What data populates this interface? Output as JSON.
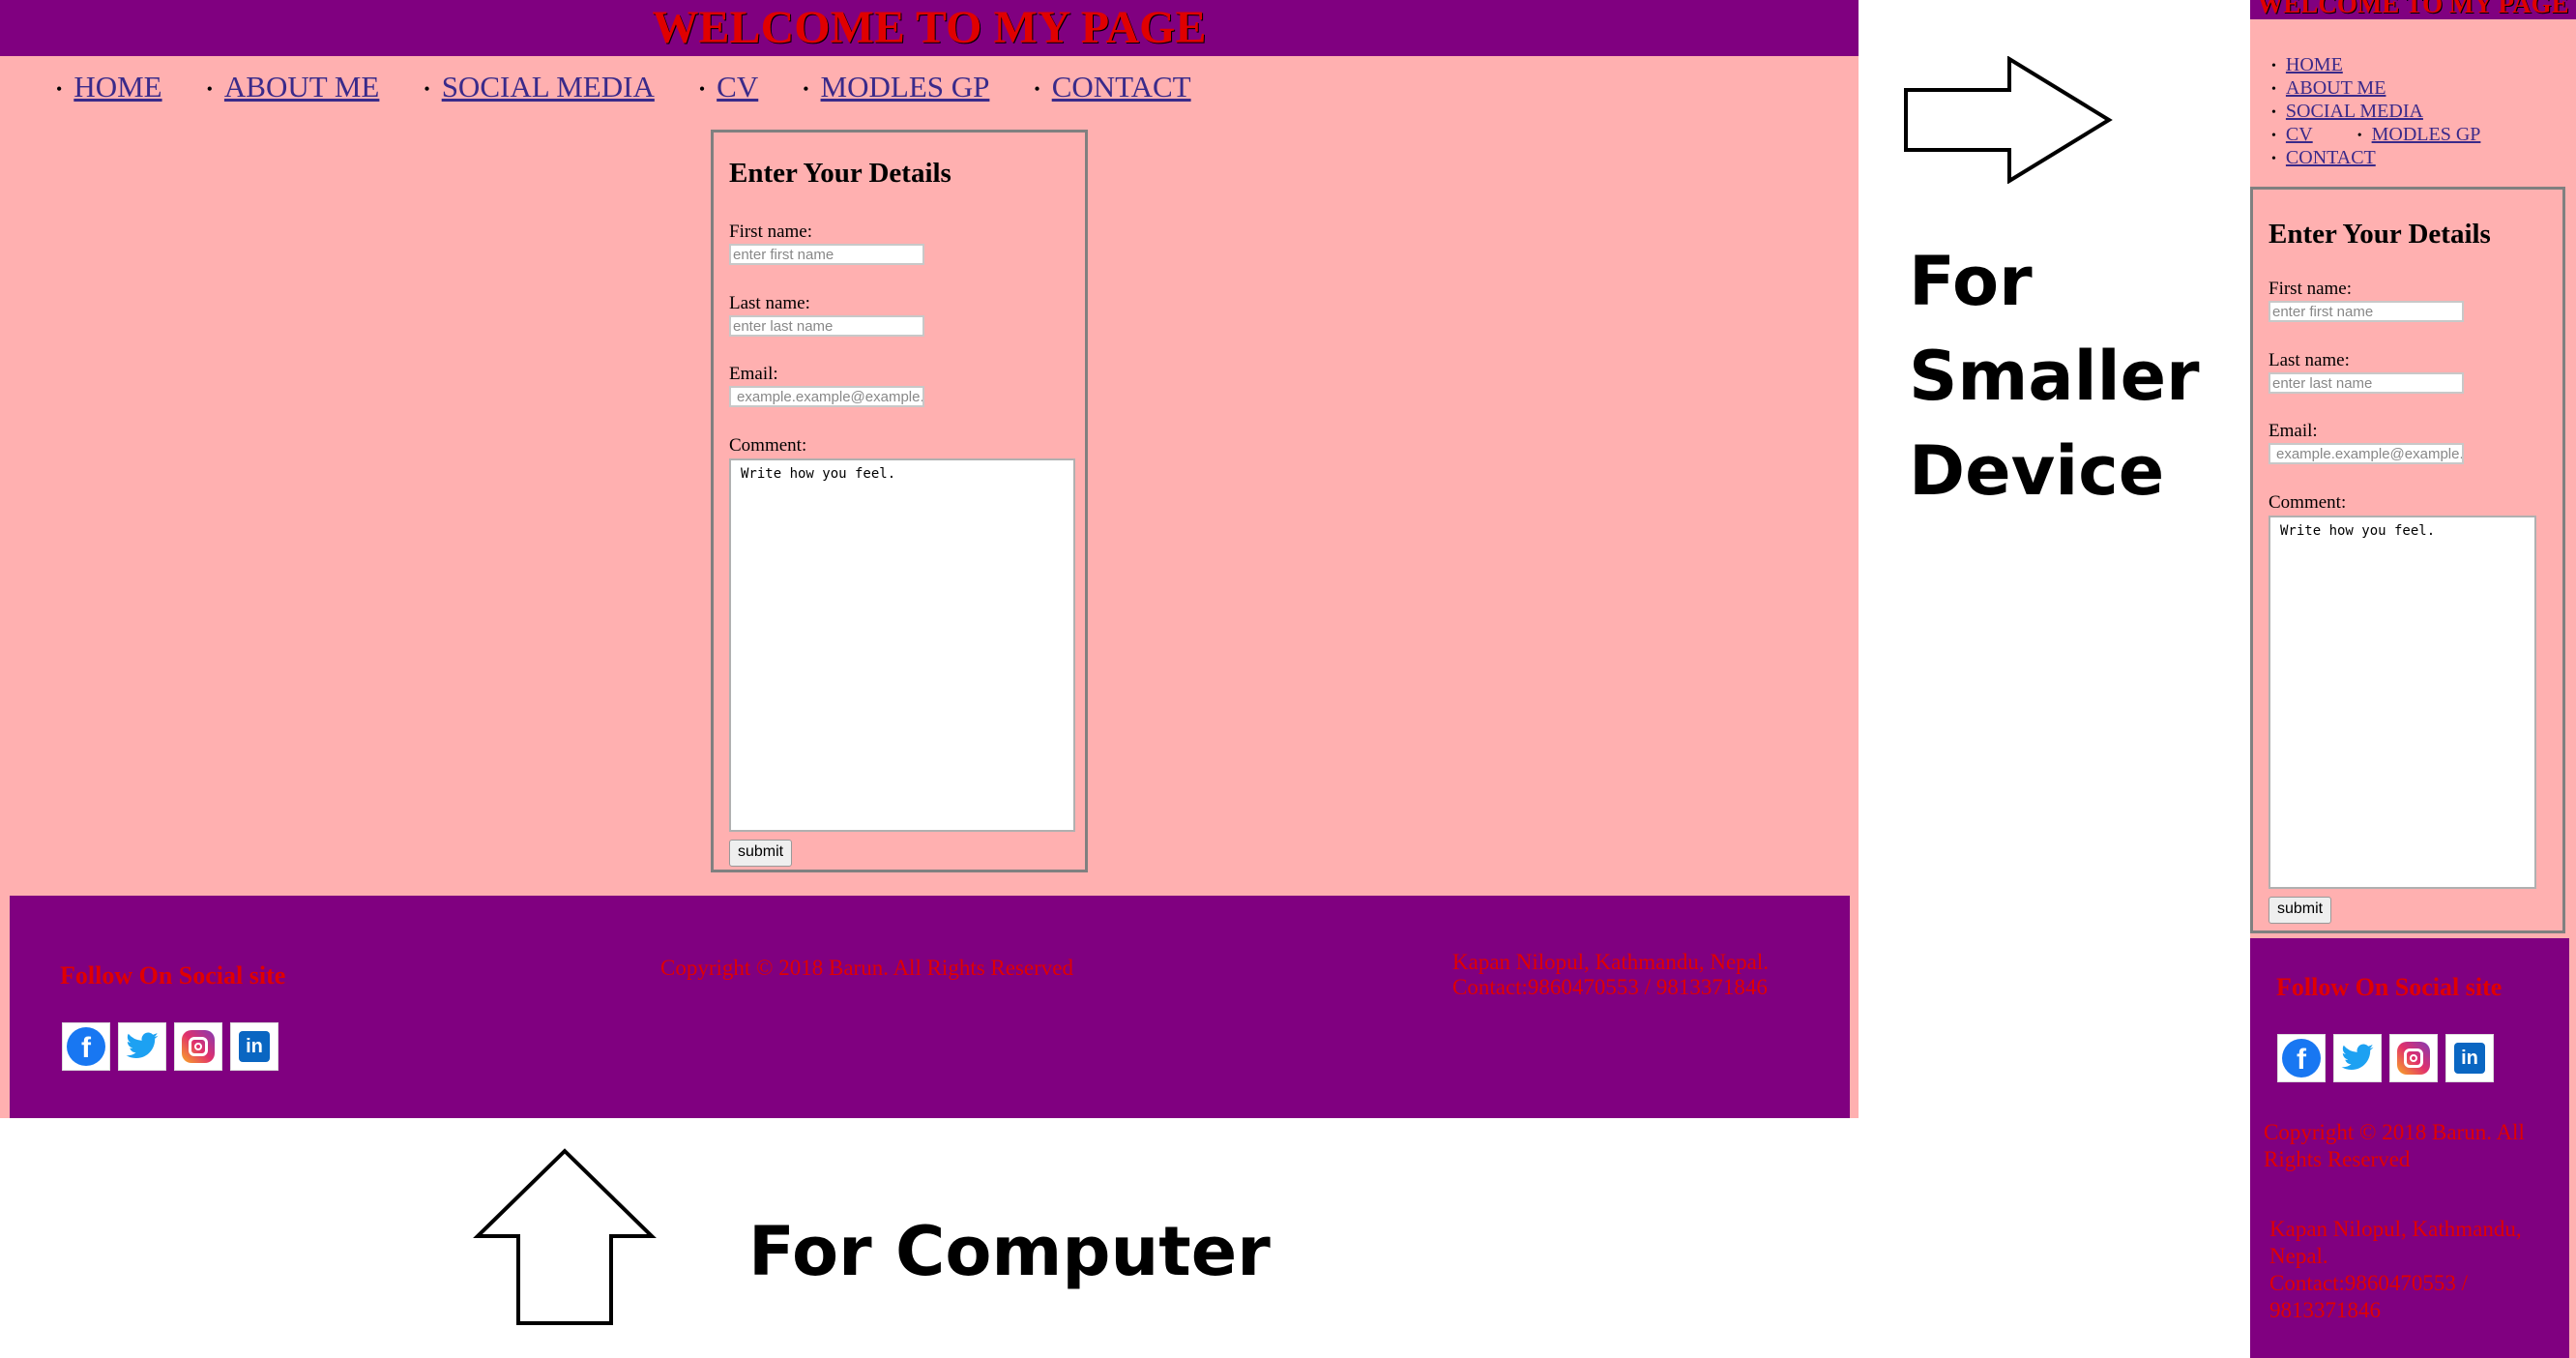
{
  "site": {
    "title": "WELCOME TO MY PAGE",
    "nav": [
      "HOME",
      "ABOUT ME",
      "SOCIAL MEDIA",
      "CV",
      "MODLES GP",
      "CONTACT"
    ]
  },
  "form": {
    "heading": "Enter Your Details",
    "first_label": "First name:",
    "first_placeholder": "enter first name",
    "last_label": "Last name:",
    "last_placeholder": "enter last name",
    "email_label": "Email:",
    "email_placeholder": "example.example@example.com",
    "comment_label": "Comment:",
    "comment_value": "Write how you feel.",
    "submit_label": "submit"
  },
  "footer": {
    "follow": "Follow On Social site",
    "copyright": "Copyright © 2018 Barun. All Rights Reserved",
    "address": "Kapan Nilopul, Kathmandu, Nepal.",
    "contact": "Contact:9860470553 / 9813371846",
    "social_icons": [
      "facebook-icon",
      "twitter-icon",
      "instagram-icon",
      "linkedin-icon"
    ]
  },
  "annotations": {
    "smaller": [
      "For",
      "Smaller",
      "Device"
    ],
    "computer": "For Computer"
  },
  "colors": {
    "header_footer": "#800080",
    "page_background": "#ffb0b0",
    "title_text": "#e00000",
    "link": "#3a2a8a"
  }
}
